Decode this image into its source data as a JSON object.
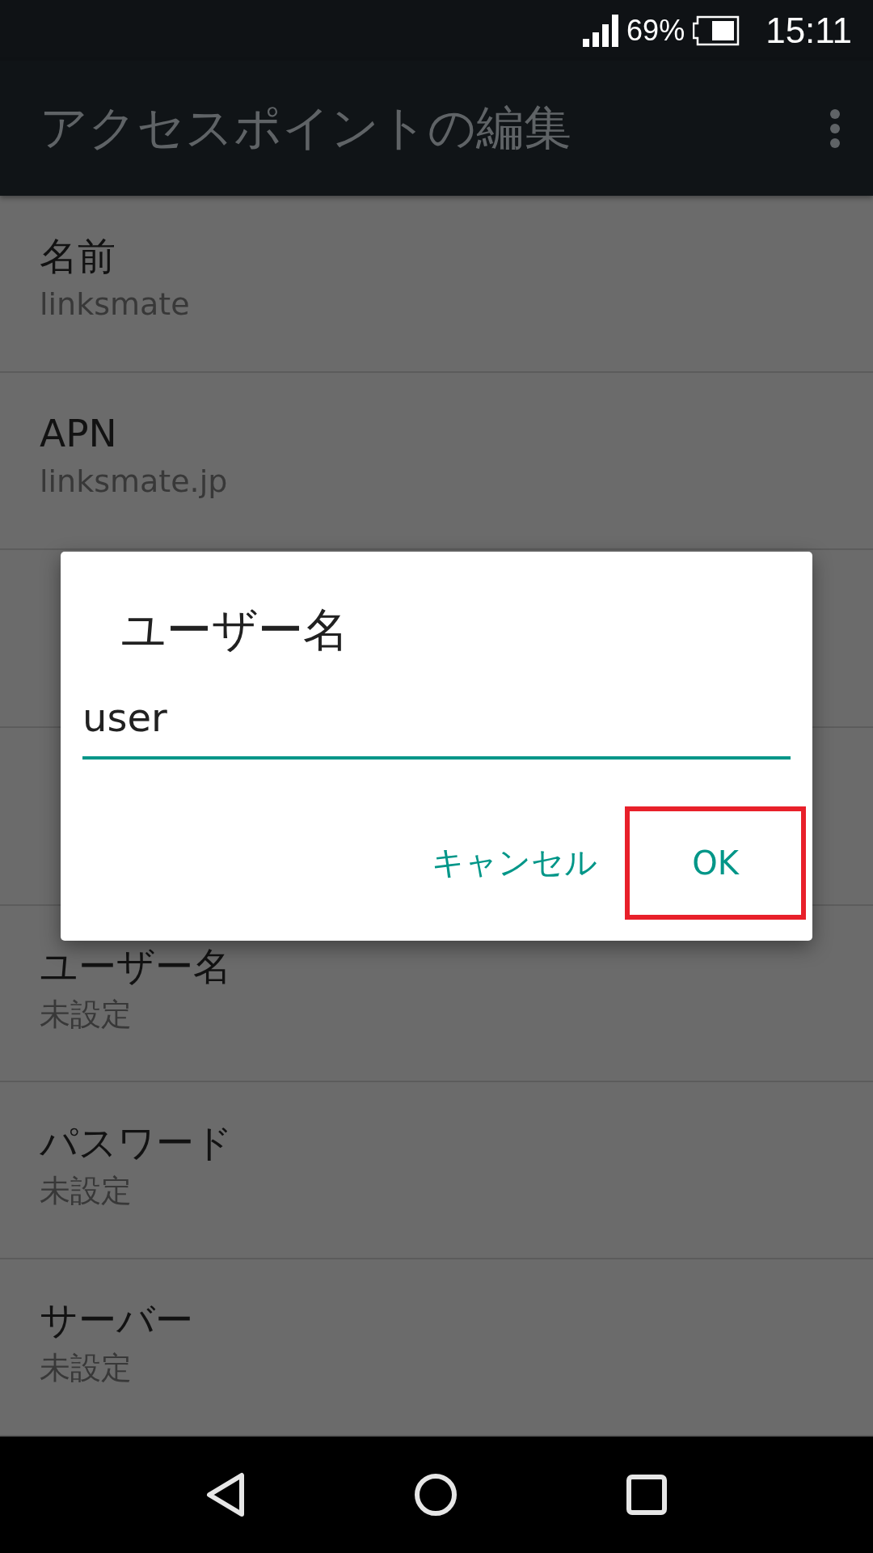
{
  "status_bar": {
    "battery_text": "69%",
    "time": "15:11"
  },
  "toolbar": {
    "title": "アクセスポイントの編集"
  },
  "settings_top": [
    {
      "title": "名前",
      "value": "linksmate"
    },
    {
      "title": "APN",
      "value": "linksmate.jp"
    }
  ],
  "settings_bottom": [
    {
      "title": "ユーザー名",
      "value": "未設定"
    },
    {
      "title": "パスワード",
      "value": "未設定"
    },
    {
      "title": "サーバー",
      "value": "未設定"
    }
  ],
  "dialog": {
    "title": "ユーザー名",
    "value": "user",
    "buttons": [
      {
        "label": "キャンセル",
        "highlighted": false
      },
      {
        "label": "OK",
        "highlighted": true
      }
    ]
  }
}
